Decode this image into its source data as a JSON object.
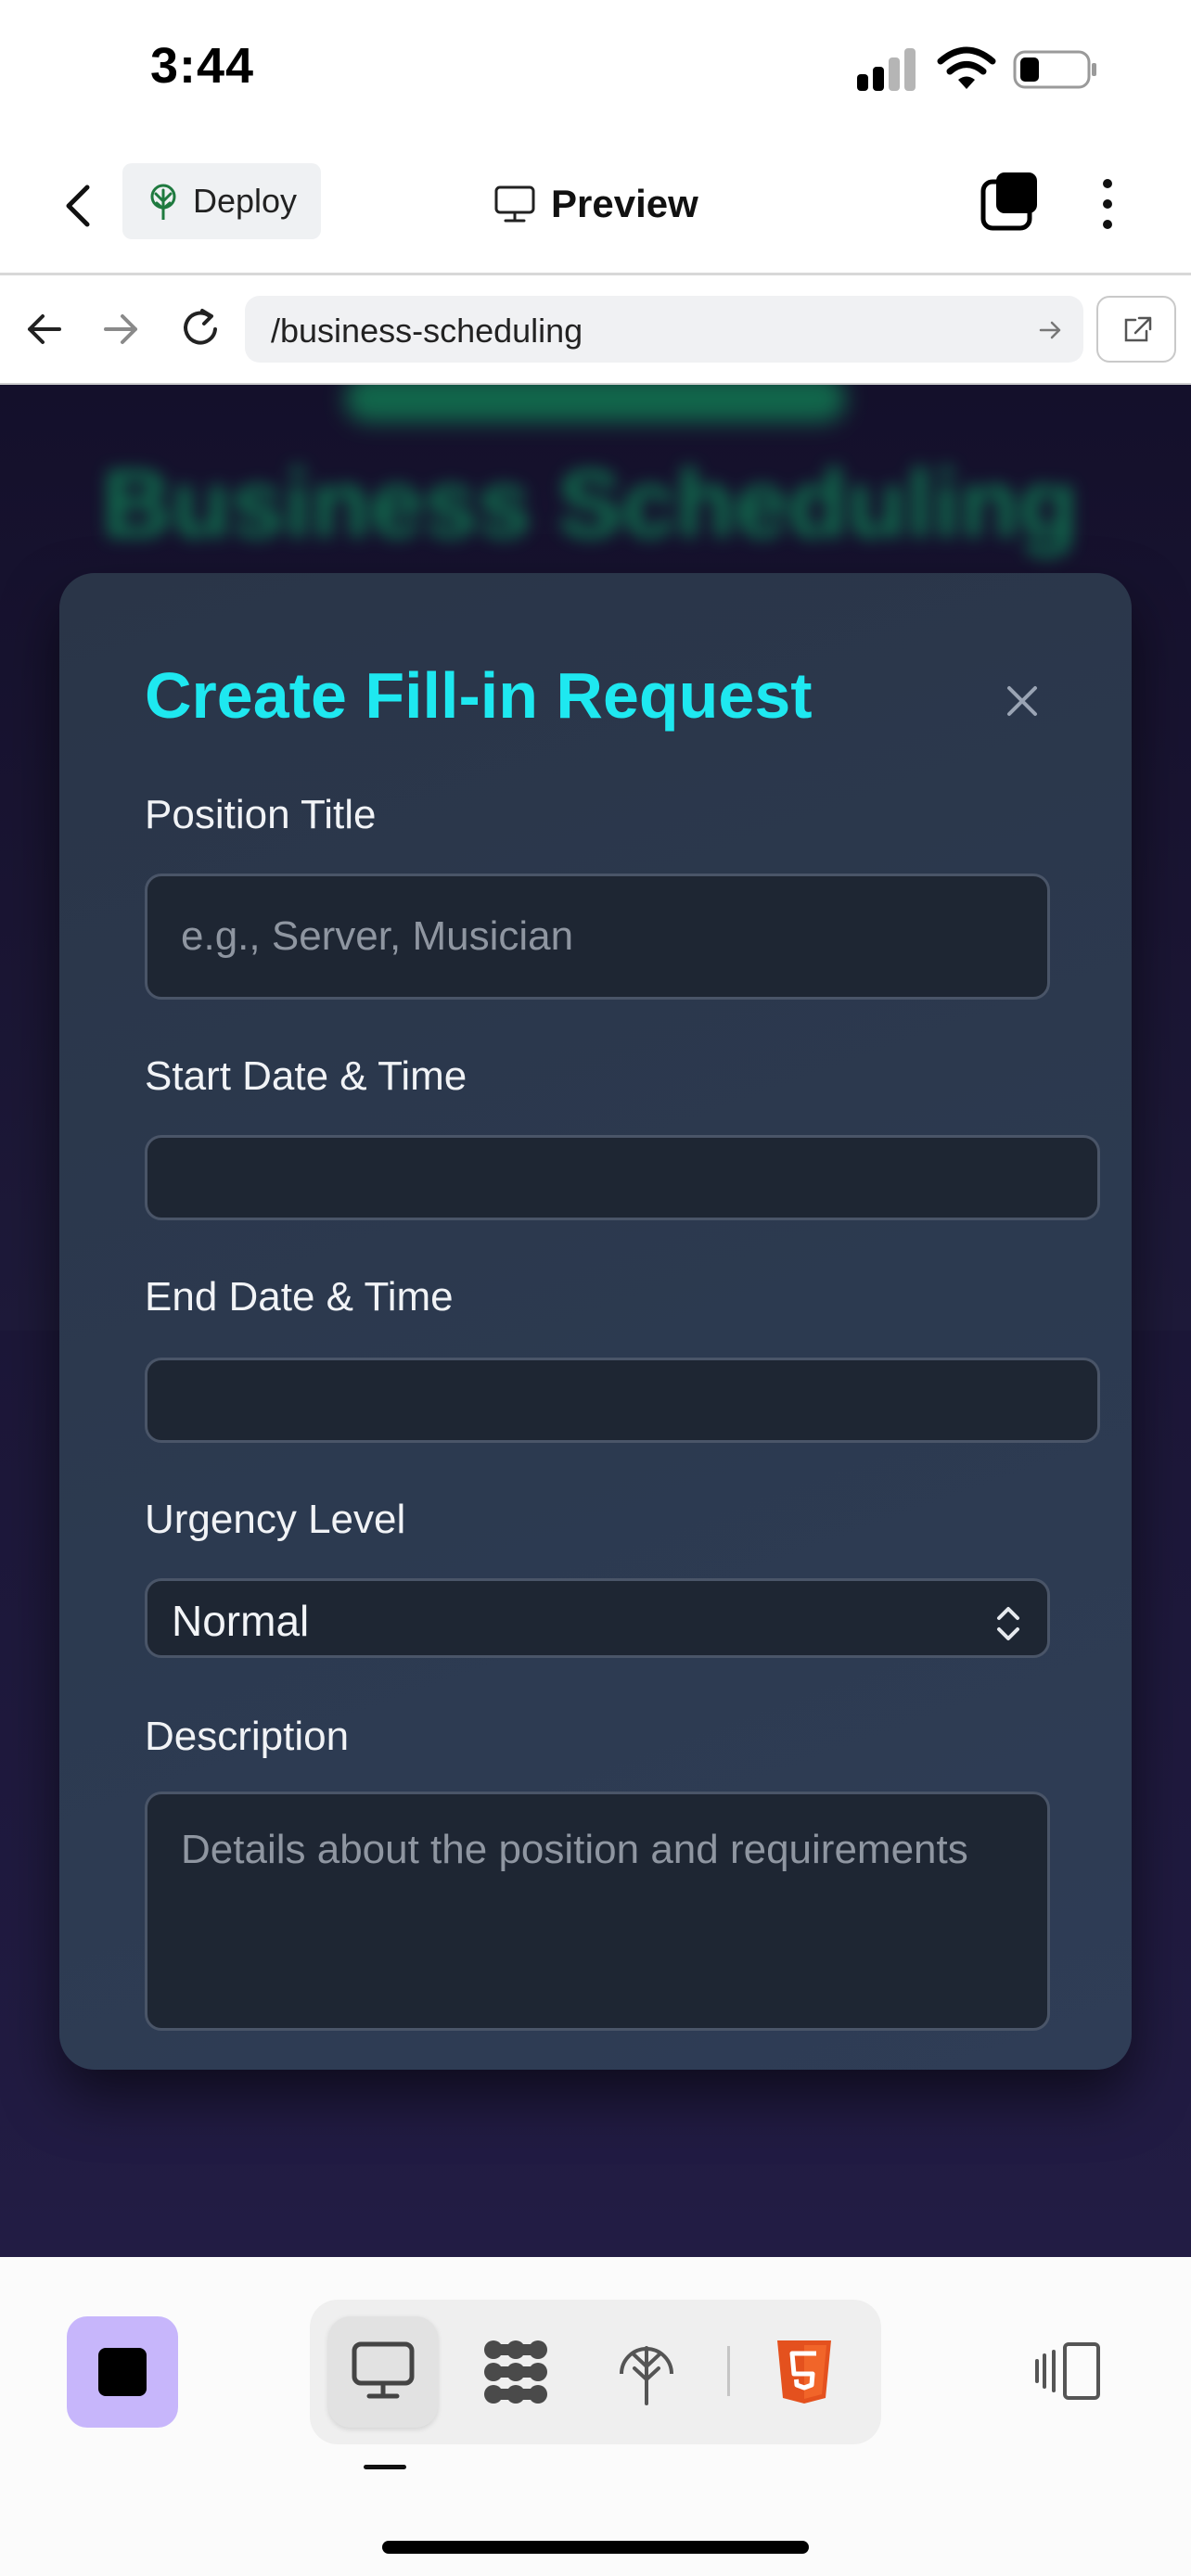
{
  "status_bar": {
    "time": "3:44"
  },
  "app_header": {
    "deploy_label": "Deploy",
    "preview_label": "Preview"
  },
  "browser": {
    "url": "/business-scheduling"
  },
  "background_page": {
    "heading": "Business Scheduling"
  },
  "modal": {
    "title": "Create Fill-in Request",
    "fields": {
      "position_title": {
        "label": "Position Title",
        "placeholder": "e.g., Server, Musician",
        "value": ""
      },
      "start": {
        "label": "Start Date & Time",
        "value": ""
      },
      "end": {
        "label": "End Date & Time",
        "value": ""
      },
      "urgency": {
        "label": "Urgency Level",
        "value": "Normal"
      },
      "description": {
        "label": "Description",
        "placeholder": "Details about the position and requirements",
        "value": ""
      }
    }
  },
  "toolbar": {
    "tools": [
      "monitor-icon",
      "shape-grid-icon",
      "deploy-tree-icon",
      "html5-icon"
    ],
    "active_tool": "monitor-icon"
  },
  "colors": {
    "modal_title": "#1ee8f0",
    "stop_button": "#c7b6fb",
    "html5_orange": "#e4511e",
    "page_background": "#1a1533"
  }
}
